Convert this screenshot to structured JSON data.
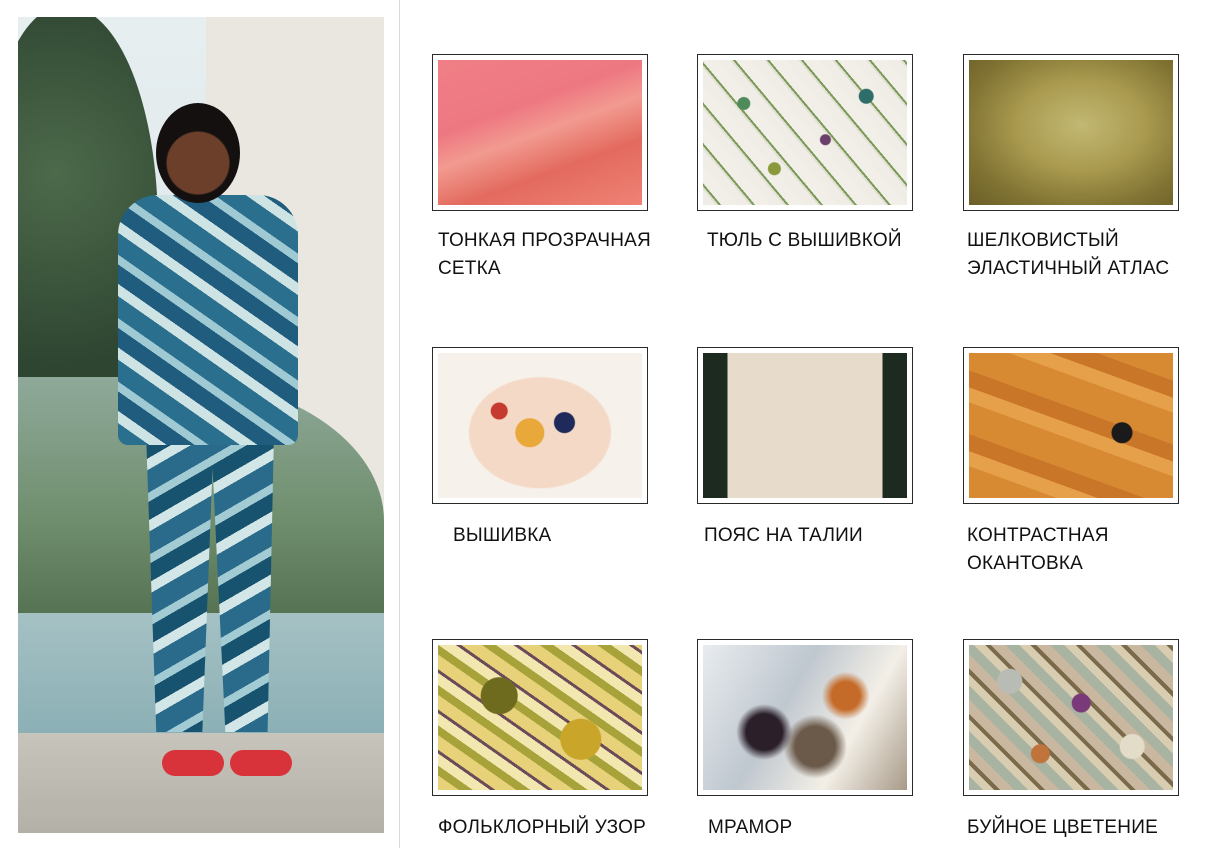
{
  "hero": {
    "alt": "Модель в пижамном костюме с тропическим принтом"
  },
  "tiles": [
    {
      "id": "mesh",
      "caption": [
        "ТОНКАЯ ПРОЗРАЧНАЯ",
        "СЕТКА"
      ]
    },
    {
      "id": "tulle",
      "caption": [
        "ТЮЛЬ С ВЫШИВКОЙ",
        ""
      ]
    },
    {
      "id": "satin",
      "caption": [
        "ШЕЛКОВИСТЫЙ",
        "ЭЛАСТИЧНЫЙ АТЛАС"
      ]
    },
    {
      "id": "embroidery",
      "caption": [
        "ВЫШИВКА",
        ""
      ]
    },
    {
      "id": "belt",
      "caption": [
        "ПОЯС НА ТАЛИИ",
        ""
      ]
    },
    {
      "id": "piping",
      "caption": [
        "КОНТРАСТНАЯ",
        "ОКАНТОВКА"
      ]
    },
    {
      "id": "folk",
      "caption": [
        "ФОЛЬКЛОРНЫЙ УЗОР",
        ""
      ]
    },
    {
      "id": "marble",
      "caption": [
        "МРАМОР",
        ""
      ]
    },
    {
      "id": "bloom",
      "caption": [
        "БУЙНОЕ ЦВЕТЕНИЕ",
        ""
      ]
    }
  ]
}
